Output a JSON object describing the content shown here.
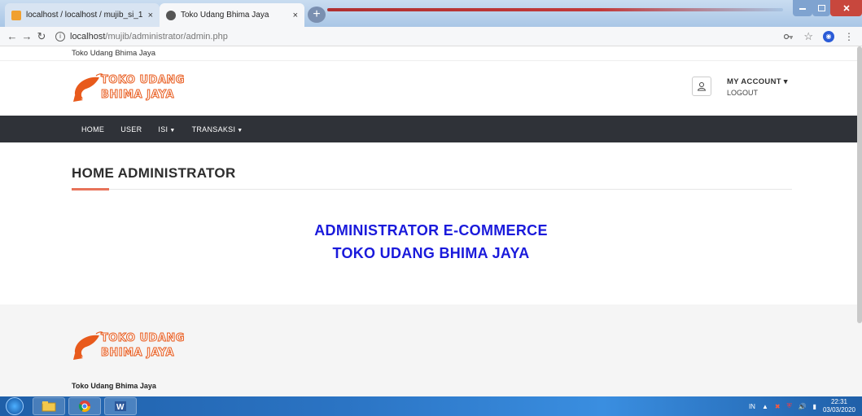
{
  "browser": {
    "tabs": [
      {
        "title": "localhost / localhost / mujib_si_1",
        "active": false
      },
      {
        "title": "Toko Udang Bhima Jaya",
        "active": true
      }
    ],
    "new_tab": "+",
    "close_glyph": "×",
    "address_host": "localhost",
    "address_path": "/mujib/administrator/admin.php"
  },
  "site": {
    "top_name": "Toko Udang Bhima Jaya",
    "logo_line1": "TOKO UDANG",
    "logo_line2": "BHIMA JAYA",
    "account_title": "MY ACCOUNT ▾",
    "account_logout": "LOGOUT",
    "nav": [
      {
        "label": "HOME",
        "has_caret": false
      },
      {
        "label": "USER",
        "has_caret": false
      },
      {
        "label": "ISI",
        "has_caret": true
      },
      {
        "label": "TRANSAKSI",
        "has_caret": true
      }
    ],
    "page_title": "HOME ADMINISTRATOR",
    "hero_line1": "ADMINISTRATOR E-COMMERCE",
    "hero_line2": "TOKO UDANG BHIMA JAYA",
    "footer_name": "Toko Udang Bhima Jaya"
  },
  "taskbar": {
    "lang": "IN",
    "time": "22:31",
    "date": "03/03/2020"
  },
  "colors": {
    "hero_text": "#1a1adb",
    "navbar_bg": "#2f3238",
    "accent": "#e8735a"
  }
}
